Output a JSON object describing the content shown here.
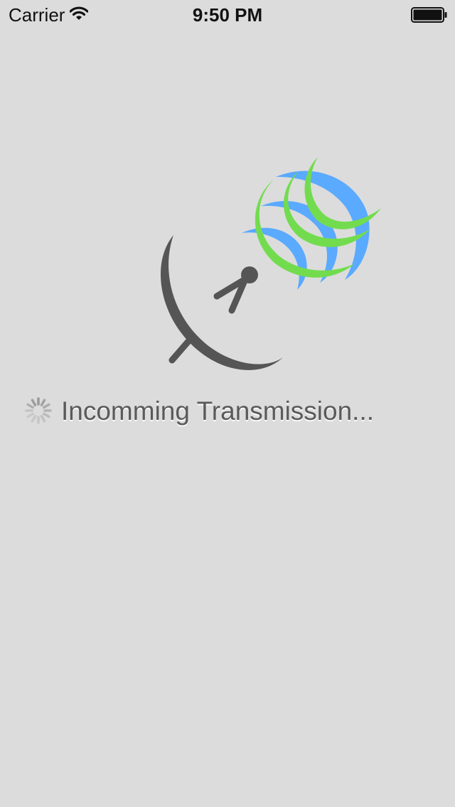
{
  "status_bar": {
    "carrier": "Carrier",
    "time": "9:50 PM",
    "wifi_icon": "wifi-icon",
    "battery_icon": "battery-full-icon"
  },
  "splash": {
    "logo_icon": "satellite-dish-icon",
    "spinner_icon": "activity-spinner-icon",
    "loading_text": "Incomming Transmission..."
  },
  "colors": {
    "background": "#dcdcdc",
    "dish": "#555555",
    "wave_blue": "#5aaaff",
    "wave_green": "#72dc4e",
    "text": "#5a5a5a"
  }
}
